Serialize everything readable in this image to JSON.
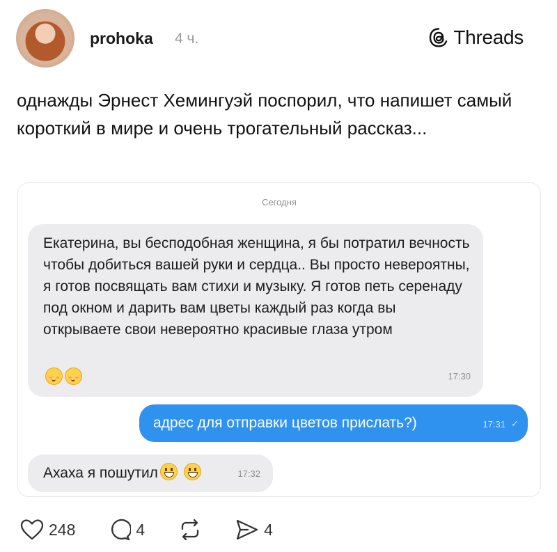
{
  "post": {
    "username": "prohoka",
    "time": "4 ч.",
    "brand": "Threads",
    "text": "однажды Эрнест Хемингуэй поспорил, что напишет самый короткий в мире и очень трогательный рассказ..."
  },
  "chat": {
    "date_label": "Сегодня",
    "messages": [
      {
        "text": "Екатерина, вы бесподобная женщина, я бы потратил вечность чтобы добиться вашей руки и сердца.. Вы просто невероятны, я готов посвящать вам стихи и музыку. Я готов петь серенаду под окном и дарить вам цветы каждый раз когда вы открываете свои невероятно красивые глаза утром",
        "emoji": [
          "smiling-face-icon",
          "smiling-face-icon"
        ],
        "time": "17:30"
      },
      {
        "text": "адрес для отправки цветов прислать?)",
        "time": "17:31"
      },
      {
        "text": "Ахаха я пошутил",
        "emoji": [
          "grinning-face-icon",
          "grinning-face-icon"
        ],
        "time": "17:32"
      }
    ]
  },
  "actions": {
    "likes": "248",
    "replies": "4",
    "shares": "4"
  },
  "colors": {
    "outgoing_bubble": "#2f92ee",
    "incoming_bubble": "#ececef"
  }
}
